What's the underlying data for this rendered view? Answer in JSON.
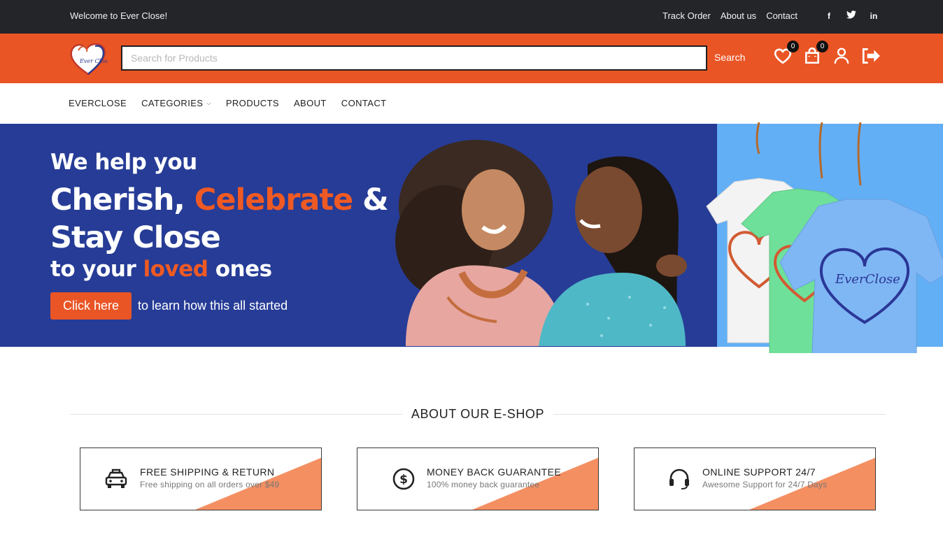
{
  "topbar": {
    "welcome": "Welcome to Ever Close!",
    "links": [
      "Track Order",
      "About us",
      "Contact"
    ],
    "social": [
      "f",
      "t",
      "in"
    ]
  },
  "header": {
    "logo_text": "Ever Close",
    "search_placeholder": "Search for Products",
    "search_label": "Search",
    "wishlist_count": "0",
    "cart_count": "0"
  },
  "nav": {
    "items": [
      "EVERCLOSE",
      "CATEGORIES",
      "PRODUCTS",
      "ABOUT",
      "CONTACT"
    ]
  },
  "hero": {
    "line1": "We help you",
    "line2_a": "Cherish, ",
    "line2_b": "Celebrate",
    "line2_c": " &",
    "line3": "Stay Close",
    "line4_a": "to your ",
    "line4_b": "loved",
    "line4_c": " ones",
    "cta": "Click here",
    "cta_tail": "to learn how this all started",
    "shirt_text": "EverClose"
  },
  "about": {
    "title": "ABOUT OUR E-SHOP",
    "cards": [
      {
        "title": "FREE SHIPPING & RETURN",
        "sub": "Free shipping on all orders over $49",
        "icon": "taxi-icon"
      },
      {
        "title": "MONEY BACK GUARANTEE",
        "sub": "100% money back guarantee",
        "icon": "dollar-icon"
      },
      {
        "title": "ONLINE SUPPORT 24/7",
        "sub": "Awesome Support for 24/7 Days",
        "icon": "headset-icon"
      }
    ]
  },
  "colors": {
    "accent": "#ea5525",
    "hero_blue": "#263c96",
    "topbar": "#232529",
    "panel_blue": "#62aff5"
  }
}
